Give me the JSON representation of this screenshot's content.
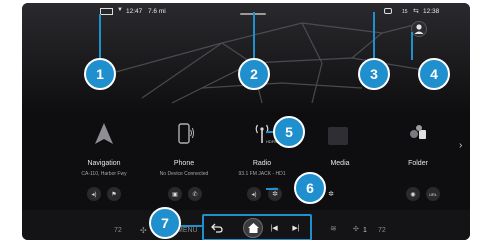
{
  "status": {
    "time_left": "12:47",
    "range": "7.6 mi",
    "time_right": "12:38",
    "badge": "15"
  },
  "callouts": [
    "1",
    "2",
    "3",
    "4",
    "5",
    "6",
    "7"
  ],
  "tiles": [
    {
      "title": "Navigation",
      "subtitle": "CA-110, Harbor Fwy"
    },
    {
      "title": "Phone",
      "subtitle": "No Device Connected"
    },
    {
      "title": "Radio",
      "subtitle": "93.1 FM JACK - HD1"
    },
    {
      "title": "Media",
      "subtitle": ""
    },
    {
      "title": "Folder",
      "subtitle": ""
    }
  ],
  "radio_logo": "HDFM",
  "folder_mini_label": "URL",
  "bottom": {
    "temp_left": "72",
    "menu_label": "MENU",
    "fan_right": "1",
    "temp_right": "72"
  },
  "icons": [
    "navigation-arrow",
    "phone",
    "radio-antenna",
    "folder-apps",
    "back",
    "home",
    "previous",
    "next",
    "fan",
    "seat-heat",
    "camera",
    "profile"
  ]
}
